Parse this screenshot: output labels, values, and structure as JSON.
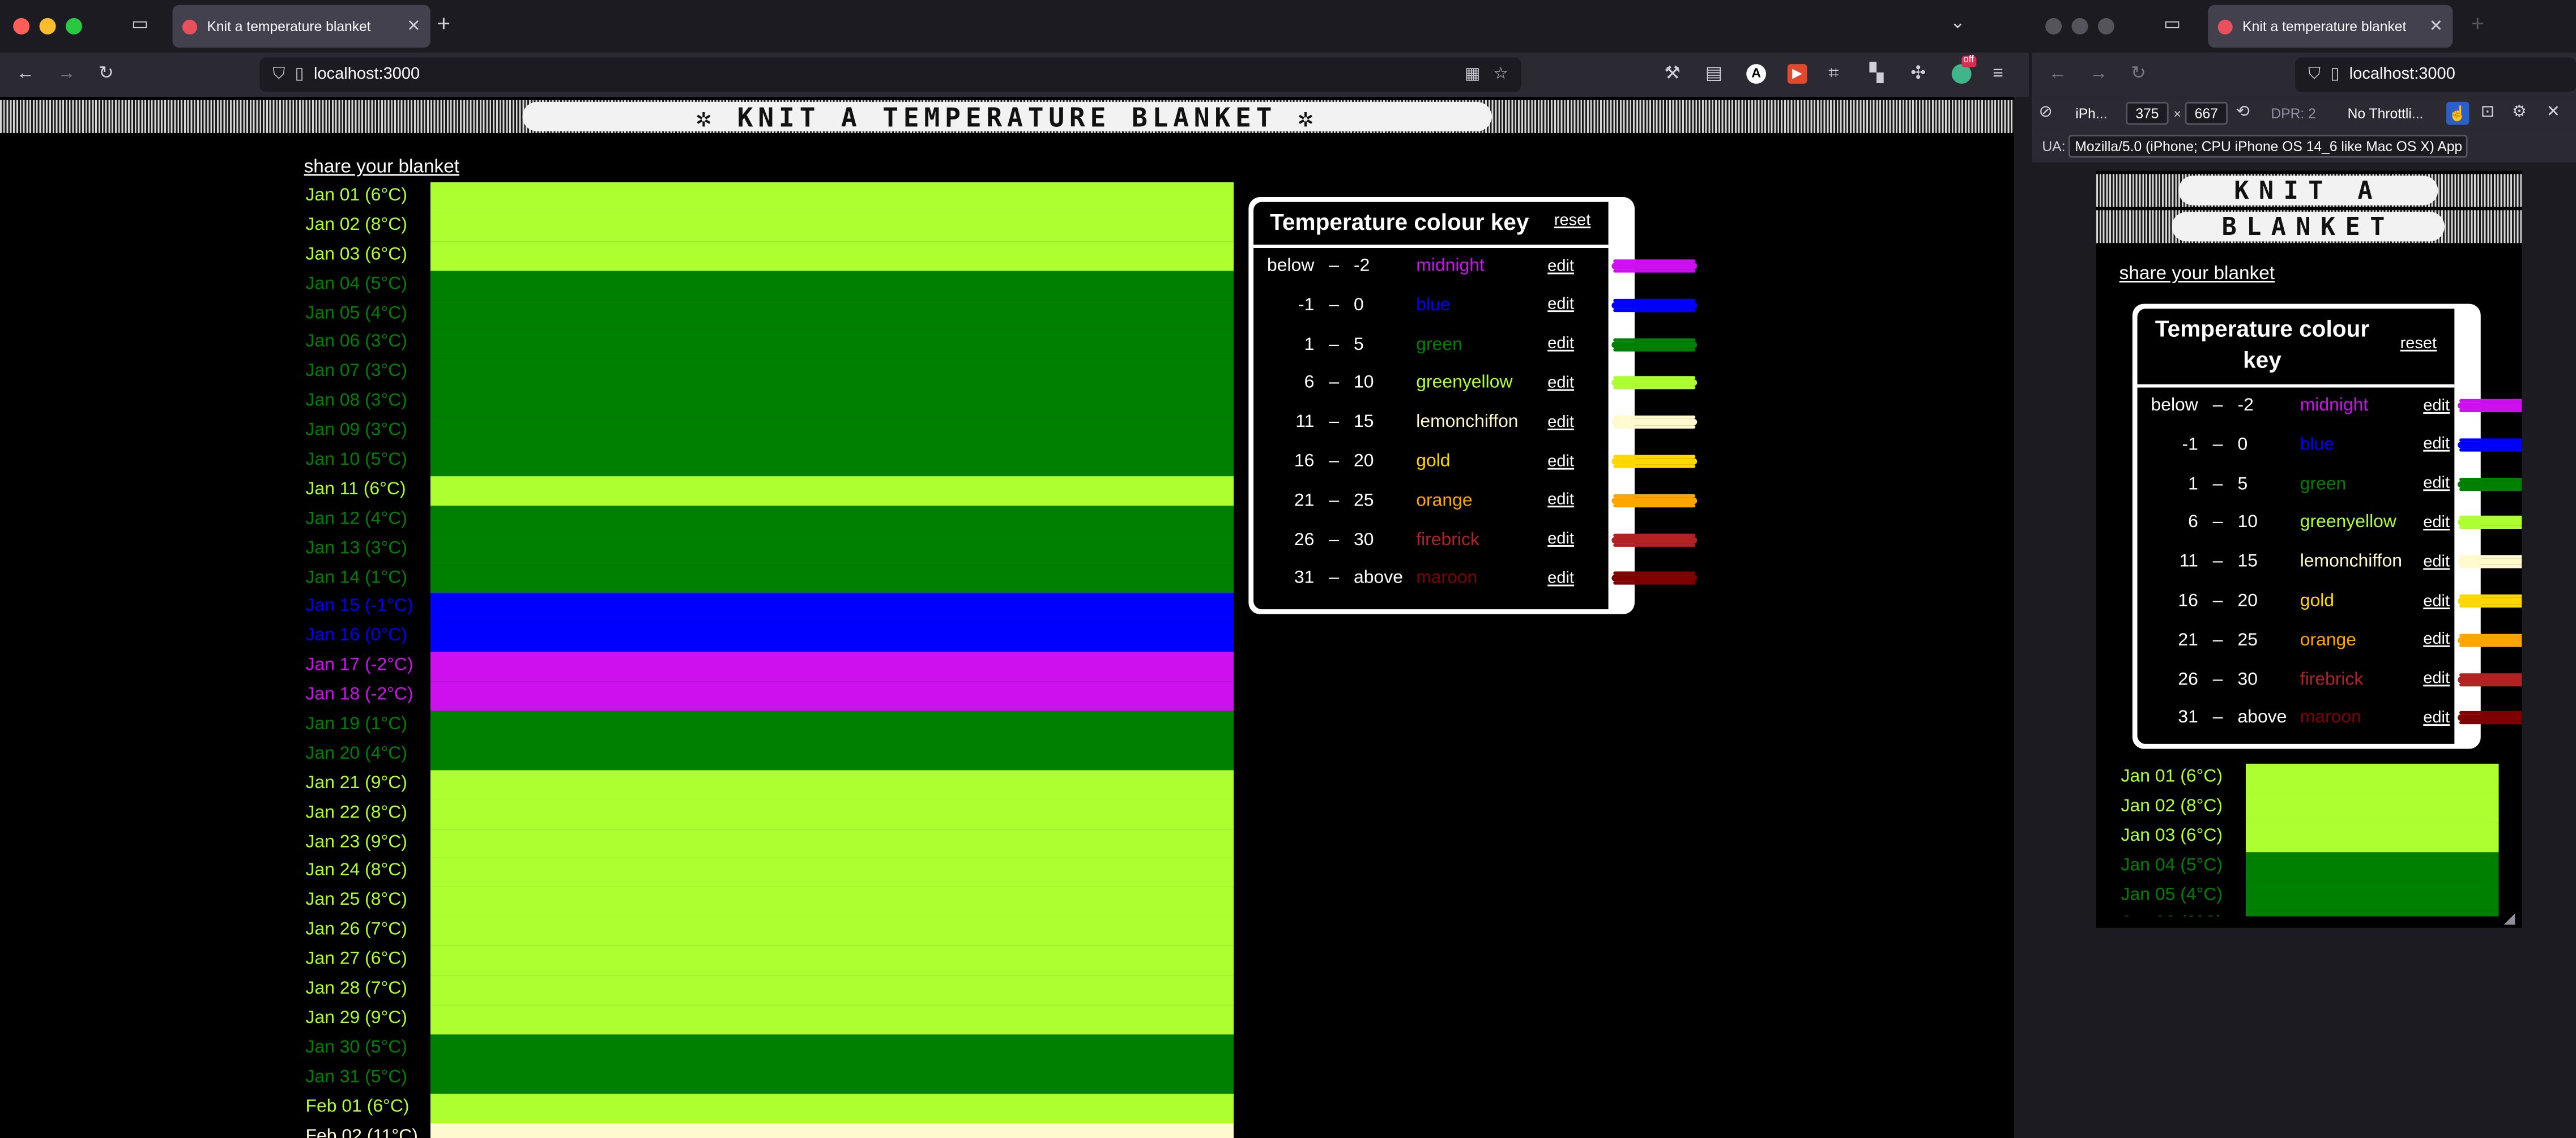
{
  "browser": {
    "tab_title": "Knit a temperature blanket",
    "url": "localhost:3000"
  },
  "page": {
    "title": "✲ KNIT A TEMPERATURE BLANKET ✲",
    "title_line1": "KNIT A",
    "title_line2": "BLANKET",
    "share_label": "share your blanket"
  },
  "colors": {
    "midnight": "#cc10ee",
    "blue": "#0000ff",
    "green": "#008000",
    "greenyellow": "#adff2f",
    "lemonchiffon": "#fffacd",
    "gold": "#ffd700",
    "orange": "#ffa500",
    "firebrick": "#b22222",
    "maroon": "#800000"
  },
  "days": [
    {
      "label": "Jan 01 (6°C)",
      "temp": 6,
      "color": "greenyellow"
    },
    {
      "label": "Jan 02 (8°C)",
      "temp": 8,
      "color": "greenyellow"
    },
    {
      "label": "Jan 03 (6°C)",
      "temp": 6,
      "color": "greenyellow"
    },
    {
      "label": "Jan 04 (5°C)",
      "temp": 5,
      "color": "green"
    },
    {
      "label": "Jan 05 (4°C)",
      "temp": 4,
      "color": "green"
    },
    {
      "label": "Jan 06 (3°C)",
      "temp": 3,
      "color": "green"
    },
    {
      "label": "Jan 07 (3°C)",
      "temp": 3,
      "color": "green"
    },
    {
      "label": "Jan 08 (3°C)",
      "temp": 3,
      "color": "green"
    },
    {
      "label": "Jan 09 (3°C)",
      "temp": 3,
      "color": "green"
    },
    {
      "label": "Jan 10 (5°C)",
      "temp": 5,
      "color": "green"
    },
    {
      "label": "Jan 11 (6°C)",
      "temp": 6,
      "color": "greenyellow"
    },
    {
      "label": "Jan 12 (4°C)",
      "temp": 4,
      "color": "green"
    },
    {
      "label": "Jan 13 (3°C)",
      "temp": 3,
      "color": "green"
    },
    {
      "label": "Jan 14 (1°C)",
      "temp": 1,
      "color": "green"
    },
    {
      "label": "Jan 15 (-1°C)",
      "temp": -1,
      "color": "blue"
    },
    {
      "label": "Jan 16 (0°C)",
      "temp": 0,
      "color": "blue"
    },
    {
      "label": "Jan 17 (-2°C)",
      "temp": -2,
      "color": "midnight"
    },
    {
      "label": "Jan 18 (-2°C)",
      "temp": -2,
      "color": "midnight"
    },
    {
      "label": "Jan 19 (1°C)",
      "temp": 1,
      "color": "green"
    },
    {
      "label": "Jan 20 (4°C)",
      "temp": 4,
      "color": "green"
    },
    {
      "label": "Jan 21 (9°C)",
      "temp": 9,
      "color": "greenyellow"
    },
    {
      "label": "Jan 22 (8°C)",
      "temp": 8,
      "color": "greenyellow"
    },
    {
      "label": "Jan 23 (9°C)",
      "temp": 9,
      "color": "greenyellow"
    },
    {
      "label": "Jan 24 (8°C)",
      "temp": 8,
      "color": "greenyellow"
    },
    {
      "label": "Jan 25 (8°C)",
      "temp": 8,
      "color": "greenyellow"
    },
    {
      "label": "Jan 26 (7°C)",
      "temp": 7,
      "color": "greenyellow"
    },
    {
      "label": "Jan 27 (6°C)",
      "temp": 6,
      "color": "greenyellow"
    },
    {
      "label": "Jan 28 (7°C)",
      "temp": 7,
      "color": "greenyellow"
    },
    {
      "label": "Jan 29 (9°C)",
      "temp": 9,
      "color": "greenyellow"
    },
    {
      "label": "Jan 30 (5°C)",
      "temp": 5,
      "color": "green"
    },
    {
      "label": "Jan 31 (5°C)",
      "temp": 5,
      "color": "green"
    },
    {
      "label": "Feb 01 (6°C)",
      "temp": 6,
      "color": "greenyellow"
    },
    {
      "label": "Feb 02 (11°C)",
      "temp": 11,
      "color": "lemonchiffon"
    }
  ],
  "key": {
    "title": "Temperature colour key",
    "title_line1": "Temperature colour",
    "title_line2": "key",
    "reset_label": "reset",
    "rows": [
      {
        "lo": "below",
        "dash": "–",
        "hi": "-2",
        "name": "midnight",
        "edit": "edit"
      },
      {
        "lo": "-1",
        "dash": "–",
        "hi": "0",
        "name": "blue",
        "edit": "edit"
      },
      {
        "lo": "1",
        "dash": "–",
        "hi": "5",
        "name": "green",
        "edit": "edit"
      },
      {
        "lo": "6",
        "dash": "–",
        "hi": "10",
        "name": "greenyellow",
        "edit": "edit"
      },
      {
        "lo": "11",
        "dash": "–",
        "hi": "15",
        "name": "lemonchiffon",
        "edit": "edit"
      },
      {
        "lo": "16",
        "dash": "–",
        "hi": "20",
        "name": "gold",
        "edit": "edit"
      },
      {
        "lo": "21",
        "dash": "–",
        "hi": "25",
        "name": "orange",
        "edit": "edit"
      },
      {
        "lo": "26",
        "dash": "–",
        "hi": "30",
        "name": "firebrick",
        "edit": "edit"
      },
      {
        "lo": "31",
        "dash": "–",
        "hi": "above",
        "name": "maroon",
        "edit": "edit"
      }
    ]
  },
  "devtools": {
    "device": "iPh...",
    "width": "375",
    "times": "×",
    "height": "667",
    "dpr": "DPR: 2",
    "throttle": "No Throttli...",
    "ua_label": "UA:",
    "ua_value": "Mozilla/5.0 (iPhone; CPU iPhone OS 14_6 like Mac OS X) App"
  },
  "extension_badge": "off"
}
